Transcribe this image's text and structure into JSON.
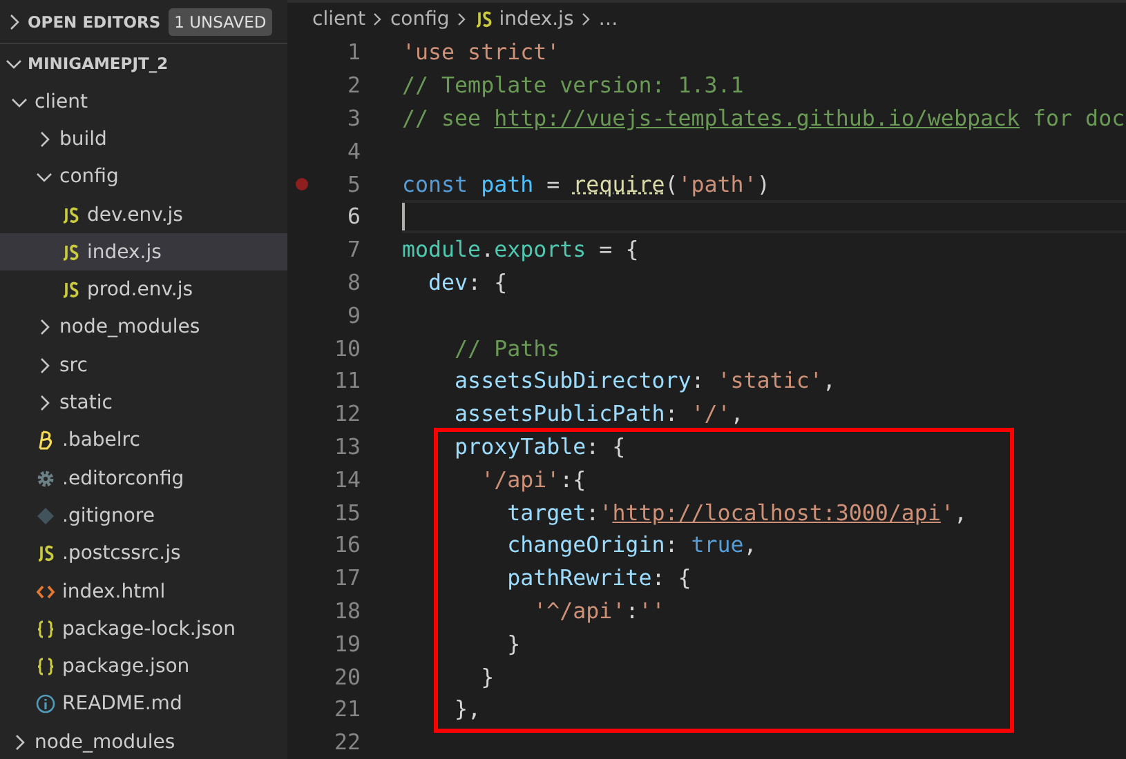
{
  "sidebar": {
    "open_editors": {
      "label": "OPEN EDITORS",
      "badge": "1 UNSAVED",
      "expanded": false
    },
    "project": {
      "label": "MINIGAMEPJT_2",
      "expanded": true,
      "children": [
        {
          "kind": "folder",
          "label": "client",
          "expanded": true,
          "selected": false,
          "children": [
            {
              "kind": "folder",
              "label": "build",
              "expanded": false,
              "selected": false
            },
            {
              "kind": "folder",
              "label": "config",
              "expanded": true,
              "selected": false,
              "children": [
                {
                  "kind": "js",
                  "label": "dev.env.js",
                  "selected": false
                },
                {
                  "kind": "js",
                  "label": "index.js",
                  "selected": true
                },
                {
                  "kind": "js",
                  "label": "prod.env.js",
                  "selected": false
                }
              ]
            },
            {
              "kind": "folder",
              "label": "node_modules",
              "expanded": false,
              "selected": false
            },
            {
              "kind": "folder",
              "label": "src",
              "expanded": false,
              "selected": false
            },
            {
              "kind": "folder",
              "label": "static",
              "expanded": false,
              "selected": false
            },
            {
              "kind": "babel",
              "label": ".babelrc",
              "selected": false
            },
            {
              "kind": "config",
              "label": ".editorconfig",
              "selected": false
            },
            {
              "kind": "git",
              "label": ".gitignore",
              "selected": false
            },
            {
              "kind": "js",
              "label": ".postcssrc.js",
              "selected": false
            },
            {
              "kind": "html",
              "label": "index.html",
              "selected": false
            },
            {
              "kind": "json",
              "label": "package-lock.json",
              "selected": false
            },
            {
              "kind": "json",
              "label": "package.json",
              "selected": false
            },
            {
              "kind": "info",
              "label": "README.md",
              "selected": false
            }
          ]
        },
        {
          "kind": "folder",
          "label": "node_modules",
          "expanded": false,
          "selected": false
        }
      ]
    }
  },
  "breadcrumbs": [
    {
      "label": "client",
      "kind": "text"
    },
    {
      "label": "config",
      "kind": "text"
    },
    {
      "label": "index.js",
      "kind": "js"
    },
    {
      "label": "…",
      "kind": "text"
    }
  ],
  "editor": {
    "lines": [
      {
        "kind": "line",
        "number": "1",
        "tokens": [
          {
            "kind": "str",
            "text": "'use strict'"
          }
        ]
      },
      {
        "kind": "line",
        "number": "2",
        "tokens": [
          {
            "kind": "com",
            "text": "// Template version: 1.3.1"
          }
        ]
      },
      {
        "kind": "line",
        "number": "3",
        "tokens": [
          {
            "kind": "com",
            "text": "// see "
          },
          {
            "kind": "comlink",
            "text": "http://vuejs-templates.github.io/webpack"
          },
          {
            "kind": "com",
            "text": " for doc"
          }
        ]
      },
      {
        "kind": "line",
        "number": "4"
      },
      {
        "kind": "line",
        "number": "5",
        "breakpoint": true,
        "tokens": [
          {
            "kind": "kw",
            "text": "const "
          },
          {
            "kind": "var",
            "text": "path"
          },
          {
            "kind": "plain",
            "text": " = "
          },
          {
            "kind": "fn",
            "text": "require"
          },
          {
            "kind": "plain",
            "text": "("
          },
          {
            "kind": "str",
            "text": "'path'"
          },
          {
            "kind": "plain",
            "text": ")"
          }
        ]
      },
      {
        "kind": "line",
        "number": "6",
        "current": true
      },
      {
        "kind": "line",
        "number": "7",
        "tokens": [
          {
            "kind": "type",
            "text": "module"
          },
          {
            "kind": "plain",
            "text": "."
          },
          {
            "kind": "type",
            "text": "exports"
          },
          {
            "kind": "plain",
            "text": " = {"
          }
        ]
      },
      {
        "kind": "line",
        "number": "8",
        "tokens": [
          {
            "kind": "prop",
            "text": "  dev"
          },
          {
            "kind": "plain",
            "text": ": {"
          }
        ]
      },
      {
        "kind": "line",
        "number": "9"
      },
      {
        "kind": "line",
        "number": "10",
        "tokens": [
          {
            "kind": "com",
            "text": "    // Paths"
          }
        ]
      },
      {
        "kind": "line",
        "number": "11",
        "tokens": [
          {
            "kind": "prop",
            "text": "    assetsSubDirectory"
          },
          {
            "kind": "plain",
            "text": ": "
          },
          {
            "kind": "str",
            "text": "'static'"
          },
          {
            "kind": "plain",
            "text": ","
          }
        ]
      },
      {
        "kind": "line",
        "number": "12",
        "tokens": [
          {
            "kind": "prop",
            "text": "    assetsPublicPath"
          },
          {
            "kind": "plain",
            "text": ": "
          },
          {
            "kind": "str",
            "text": "'/'"
          },
          {
            "kind": "plain",
            "text": ","
          }
        ]
      },
      {
        "kind": "highlight",
        "lines": [
          {
            "kind": "line",
            "number": "13",
            "tokens": [
              {
                "kind": "prop",
                "text": "    proxyTable"
              },
              {
                "kind": "plain",
                "text": ": {"
              }
            ]
          },
          {
            "kind": "line",
            "number": "14",
            "tokens": [
              {
                "kind": "str",
                "text": "      '/api'"
              },
              {
                "kind": "plain",
                "text": ":{"
              }
            ]
          },
          {
            "kind": "line",
            "number": "15",
            "tokens": [
              {
                "kind": "prop",
                "text": "        target"
              },
              {
                "kind": "plain",
                "text": ":"
              },
              {
                "kind": "str",
                "text": "'"
              },
              {
                "kind": "strlink",
                "text": "http://localhost:3000/api"
              },
              {
                "kind": "str",
                "text": "'"
              },
              {
                "kind": "plain",
                "text": ","
              }
            ]
          },
          {
            "kind": "line",
            "number": "16",
            "tokens": [
              {
                "kind": "prop",
                "text": "        changeOrigin"
              },
              {
                "kind": "plain",
                "text": ": "
              },
              {
                "kind": "kw",
                "text": "true"
              },
              {
                "kind": "plain",
                "text": ","
              }
            ]
          },
          {
            "kind": "line",
            "number": "17",
            "tokens": [
              {
                "kind": "prop",
                "text": "        pathRewrite"
              },
              {
                "kind": "plain",
                "text": ": {"
              }
            ]
          },
          {
            "kind": "line",
            "number": "18",
            "tokens": [
              {
                "kind": "str",
                "text": "          '^/api'"
              },
              {
                "kind": "plain",
                "text": ":"
              },
              {
                "kind": "str",
                "text": "''"
              }
            ]
          },
          {
            "kind": "line",
            "number": "19",
            "tokens": [
              {
                "kind": "plain",
                "text": "        }"
              }
            ]
          },
          {
            "kind": "line",
            "number": "20",
            "tokens": [
              {
                "kind": "plain",
                "text": "      }"
              }
            ]
          },
          {
            "kind": "line",
            "number": "21",
            "tokens": [
              {
                "kind": "plain",
                "text": "    },"
              }
            ]
          }
        ]
      },
      {
        "kind": "line",
        "number": "22"
      }
    ]
  }
}
